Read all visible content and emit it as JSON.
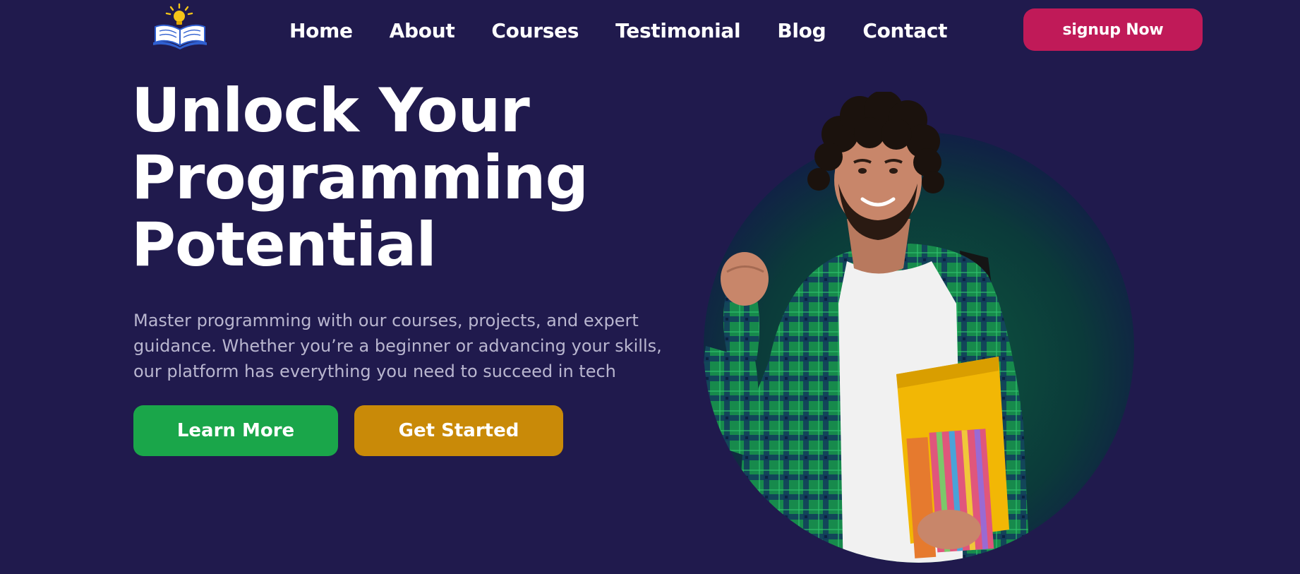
{
  "brand": {
    "logo_icon": "open-book-with-lightbulb-icon"
  },
  "nav": {
    "items": [
      {
        "label": "Home"
      },
      {
        "label": "About"
      },
      {
        "label": "Courses"
      },
      {
        "label": "Testimonial"
      },
      {
        "label": "Blog"
      },
      {
        "label": "Contact"
      }
    ]
  },
  "header": {
    "signup_label": "signup Now"
  },
  "hero": {
    "title_lines": [
      "Unlock Your",
      "Programming",
      "Potential"
    ],
    "description_lines": [
      "Master programming with our courses, projects, and expert",
      "guidance. Whether you’re a beginner or advancing your skills,",
      "our platform has everything you need to succeed in tech"
    ],
    "primary_button": "Learn More",
    "secondary_button": "Get Started",
    "image_icon": "student-photo"
  },
  "colors": {
    "background": "#201a4d",
    "signup": "#c01a58",
    "learn_more": "#1aa64a",
    "get_started": "#c98a08",
    "description_text": "#b9b6cf"
  }
}
